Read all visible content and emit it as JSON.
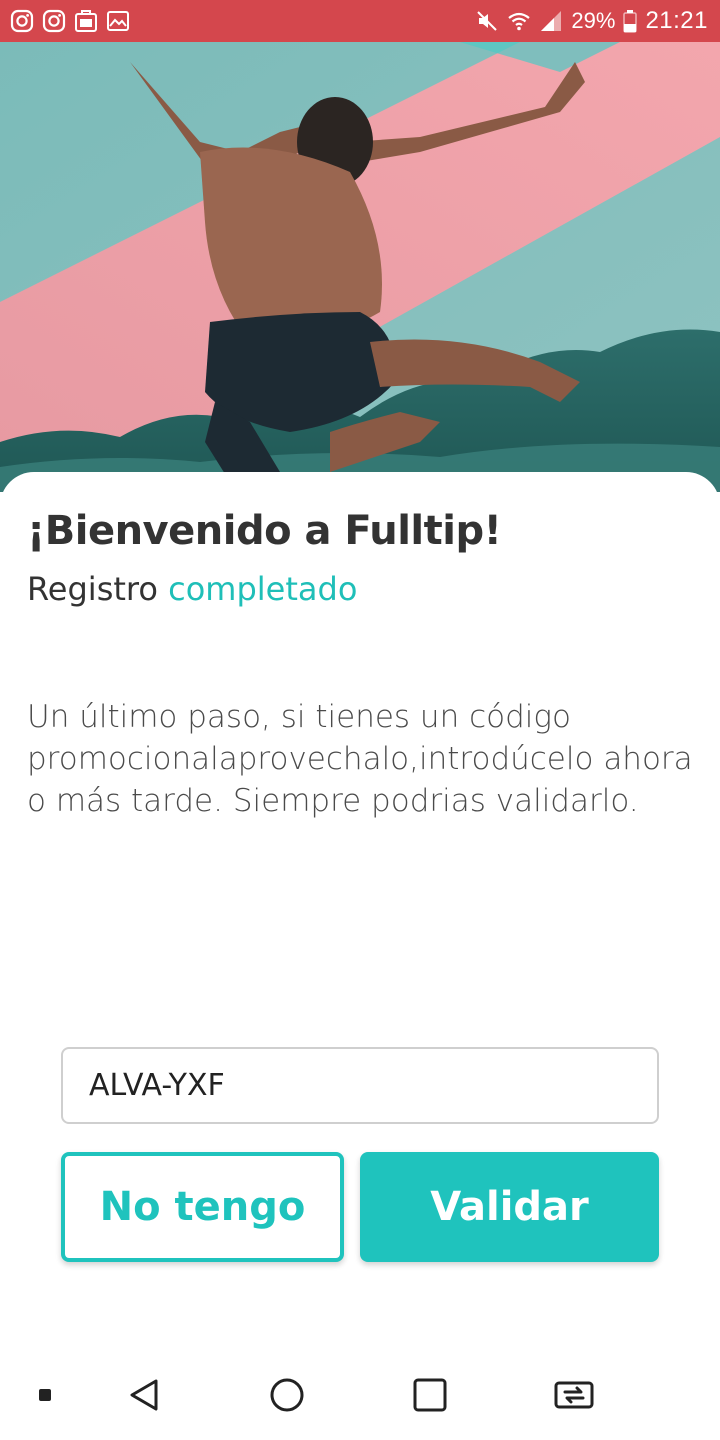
{
  "status_bar": {
    "left_icons": [
      "instagram-icon",
      "instagram-icon",
      "lg-app-icon",
      "gallery-icon"
    ],
    "battery": "29%",
    "time": "21:21",
    "color": "#d4474d"
  },
  "hero": {
    "image": "jumping-man-photo"
  },
  "welcome": {
    "title": "¡Bienvenido a Fulltip!",
    "subtitle_prefix": "Registro",
    "subtitle_accent": "completado",
    "body": "Un último paso, si tienes un código promocionalaprovechalo,introdúcelo ahora o más tarde. Siempre podrias validarlo."
  },
  "promo": {
    "code_value": "ALVA-YXF"
  },
  "buttons": {
    "no_code_label": "No tengo",
    "validate_label": "Validar",
    "accent": "#1fc3bd"
  },
  "nav_bar": {
    "icons": [
      "notification-dot-icon",
      "back-icon",
      "home-icon",
      "recents-icon",
      "switch-app-icon"
    ]
  }
}
